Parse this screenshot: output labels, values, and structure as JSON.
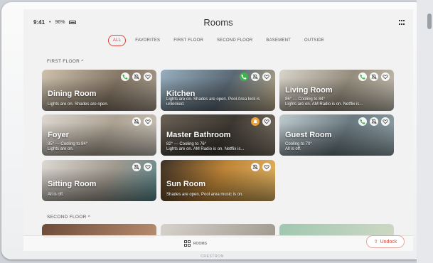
{
  "status": {
    "time": "9:41",
    "battery": "96%"
  },
  "header": {
    "title": "Rooms"
  },
  "filters": [
    "ALL",
    "FAVORITES",
    "FIRST FLOOR",
    "SECOND FLOOR",
    "BASEMENT",
    "OUTSIDE"
  ],
  "active_filter": "ALL",
  "sections": {
    "first_floor": "FIRST FLOOR ^",
    "second_floor": "SECOND FLOOR ^"
  },
  "rooms": [
    {
      "name": "Dining Room",
      "status": "Lights are on. Shades are open.",
      "icons": [
        "phone-icon",
        "bell-muted-icon",
        "heart-icon"
      ]
    },
    {
      "name": "Kitchen",
      "status": "Lights are on. Shades are open. Pool Area lock is unlocked.",
      "icons": [
        "phone-green-icon",
        "bell-muted-icon",
        "heart-icon"
      ]
    },
    {
      "name": "Living Room",
      "status": "86° — Cooling to 84°\nLights are on. AM Radio is on. Netflix is...",
      "icons": [
        "phone-icon",
        "bell-muted-icon",
        "heart-icon"
      ]
    },
    {
      "name": "Foyer",
      "status": "85° — Cooling to 84°\nLights are on.",
      "icons": [
        "bell-muted-icon",
        "heart-icon"
      ]
    },
    {
      "name": "Master Bathroom",
      "status": "82° — Cooling to 76°\nLights are on. AM Radio is on. Netflix is...",
      "icons": [
        "bell-orange-icon",
        "heart-icon"
      ]
    },
    {
      "name": "Guest Room",
      "status": "Cooling to 70°\nAll is off.",
      "icons": [
        "phone-icon",
        "bell-muted-icon",
        "heart-icon"
      ]
    },
    {
      "name": "Sitting Room",
      "status": "All is off.",
      "icons": [
        "bell-muted-icon",
        "heart-icon"
      ]
    },
    {
      "name": "Sun Room",
      "status": "Shades are open. Pool area music is on.",
      "icons": [
        "bell-muted-icon",
        "heart-icon"
      ]
    }
  ],
  "bottom": {
    "rooms_label": "ROOMS",
    "undock_label": "Undock"
  },
  "brand": "CRESTRON"
}
